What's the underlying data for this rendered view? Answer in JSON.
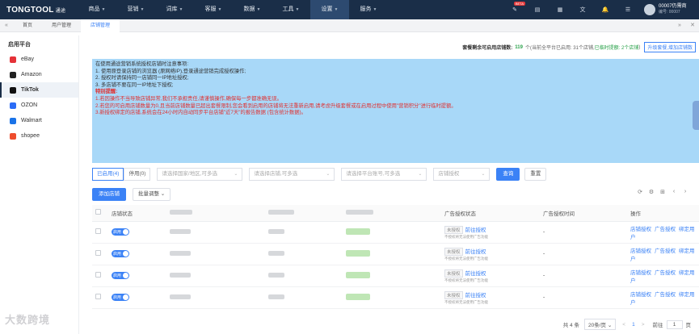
{
  "app": {
    "logo": "TONGTOOL",
    "logo_sub": "通途"
  },
  "nav": {
    "items": [
      {
        "label": "商品",
        "active": false
      },
      {
        "label": "营销",
        "active": false
      },
      {
        "label": "词库",
        "active": false
      },
      {
        "label": "客服",
        "active": false
      },
      {
        "label": "数据",
        "active": false
      },
      {
        "label": "工具",
        "active": false
      },
      {
        "label": "设置",
        "active": true
      },
      {
        "label": "服务",
        "active": false
      }
    ],
    "beta_badge": "BETA",
    "user_name": "00007仍需商",
    "user_id": "编号: 00007"
  },
  "tabs": {
    "items": [
      {
        "label": "首页",
        "active": false
      },
      {
        "label": "用户管理",
        "active": false
      },
      {
        "label": "店铺管理",
        "active": true
      }
    ]
  },
  "sidebar": {
    "title": "启用平台",
    "items": [
      {
        "label": "eBay",
        "color": "#e53238",
        "active": false
      },
      {
        "label": "Amazon",
        "color": "#222222",
        "active": false
      },
      {
        "label": "TikTok",
        "color": "#111111",
        "active": true
      },
      {
        "label": "OZON",
        "color": "#2b6cf6",
        "active": false
      },
      {
        "label": "Walmart",
        "color": "#1a73e8",
        "active": false
      },
      {
        "label": "shopee",
        "color": "#ee4d2d",
        "active": false
      }
    ]
  },
  "quota": {
    "label": "套餐剩余可启用店铺数:",
    "count": "119",
    "detail": "个(当前全平台已启用: 31个店铺,",
    "bright": "已临时提额: 2个店铺",
    "close": ")",
    "upgrade": "升级套餐,增加店铺数"
  },
  "notice": {
    "lines": [
      {
        "text": "在使用通途营销系统授权店铺时注意事项:",
        "style": "dark"
      },
      {
        "text": "1. 使用原登录店铺的浏览器 (原网络IP),登录通途营销完成授权操作;",
        "style": "dark"
      },
      {
        "text": "2. 授权时请保持同一店铺同一IP地址授权;",
        "style": "dark"
      },
      {
        "text": "3. 多店铺不要在同一IP地址下授权;",
        "style": "dark"
      },
      {
        "text": "特别提醒:",
        "style": "head"
      },
      {
        "text": "1.若因操作不当导致店铺异常,我们不承担责任,请谨慎操作,确保每一步都准确无误。",
        "style": "red"
      },
      {
        "text": "2.若您的可启用店铺数量为0,且当前店铺数量已超出套餐限制,您会看到启用的店铺将无法重新启用,请考虑升级套餐或在启用过程中使用\"营销积分\"进行临时提额。",
        "style": "red"
      },
      {
        "text": "3.新授权绑定的店铺,系统会在24小时内自动同步平台店铺\"近7天\"的报告数据 (包含统计数据)。",
        "style": "red"
      }
    ]
  },
  "filters": {
    "enabled": "已启用(4)",
    "disabled": "停用(0)",
    "country_placeholder": "请选择国家/地区,可多选",
    "store_placeholder": "请选择店铺,可多选",
    "account_placeholder": "请选择平台账号,可多选",
    "auth_placeholder": "店铺授权",
    "search": "查询",
    "reset": "重置"
  },
  "toolbar": {
    "add": "添加店铺",
    "batch": "批量调整"
  },
  "table": {
    "headers": [
      "店铺状态",
      "",
      "",
      "",
      "广告授权状态",
      "广告授权时间",
      "操作"
    ],
    "rows": [
      {
        "status": "启用",
        "auth_tag": "未授权",
        "auth_link": "前往授权",
        "auth_note": "不授权将无法使用广告功能",
        "auth_time": "-",
        "ops": [
          "店铺授权",
          "广告授权",
          "绑定用户"
        ]
      },
      {
        "status": "启用",
        "auth_tag": "未授权",
        "auth_link": "前往授权",
        "auth_note": "不授权将无法使用广告功能",
        "auth_time": "-",
        "ops": [
          "店铺授权",
          "广告授权",
          "绑定用户"
        ]
      },
      {
        "status": "启用",
        "auth_tag": "未授权",
        "auth_link": "前往授权",
        "auth_note": "不授权将无法使用广告功能",
        "auth_time": "-",
        "ops": [
          "店铺授权",
          "广告授权",
          "绑定用户"
        ]
      },
      {
        "status": "启用",
        "auth_tag": "未授权",
        "auth_link": "前往授权",
        "auth_note": "不授权将无法使用广告功能",
        "auth_time": "-",
        "ops": [
          "店铺授权",
          "广告授权",
          "绑定用户"
        ]
      }
    ]
  },
  "pagination": {
    "total": "共 4 条",
    "size": "20条/页",
    "prev": "<",
    "page": "1",
    "next": ">",
    "goto_label": "前往",
    "goto_value": "1",
    "unit": "页"
  },
  "watermark": "大数跨境"
}
